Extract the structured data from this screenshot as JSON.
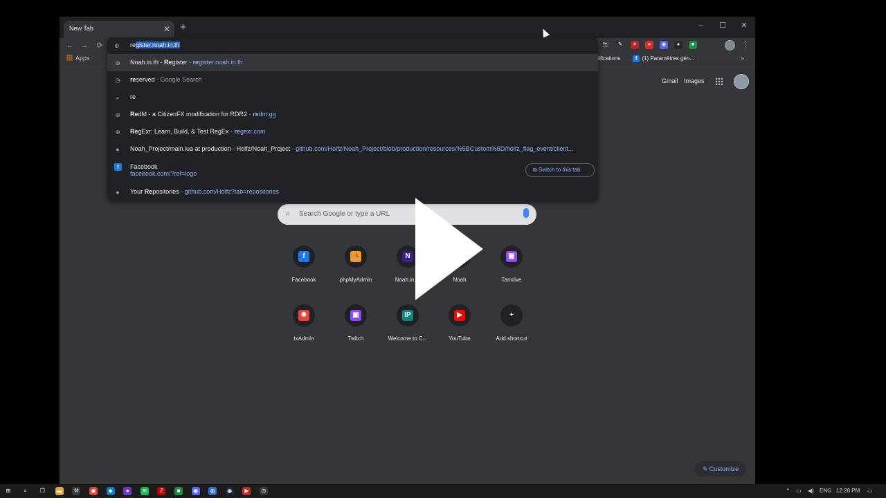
{
  "browser": {
    "tab_title": "New Tab",
    "tab_close": "✕",
    "new_tab": "+",
    "window_controls": [
      "–",
      "☐",
      "✕"
    ],
    "nav": {
      "back": "←",
      "forward": "→",
      "reload": "⟳",
      "site": "⊕"
    },
    "extensions": [
      {
        "name": "camera-extension-icon",
        "glyph": "📷",
        "color": "#35363a"
      },
      {
        "name": "pen-extension-icon",
        "glyph": "✎",
        "color": "#35363a"
      },
      {
        "name": "vpn-extension-icon",
        "glyph": "✕",
        "color": "#b3262b"
      },
      {
        "name": "ladybug-extension-icon",
        "glyph": "●",
        "color": "#d93025"
      },
      {
        "name": "discord-extension-icon",
        "glyph": "◉",
        "color": "#5865f2"
      },
      {
        "name": "github-extension-icon",
        "glyph": "●",
        "color": "#24292e"
      },
      {
        "name": "green-extension-icon",
        "glyph": "■",
        "color": "#1e8e3e"
      }
    ],
    "kebab": "⋮",
    "bookmarks": {
      "apps_label": "Apps",
      "notifications_label": "tifications",
      "parametres_label": "(1) Paramètres gén...",
      "more": "»"
    }
  },
  "omnibox": {
    "typed": "re",
    "autocomplete": "gister.noah.in.th",
    "suggestions": [
      {
        "icon": "⊕",
        "bold": "",
        "title": "Noah.in.th - ",
        "title_bold": "Re",
        "title_rest": "gister",
        "sep": " - ",
        "url_bold": "re",
        "url": "gister.noah.in.th"
      },
      {
        "icon": "◷",
        "bold": "re",
        "title": "served",
        "sep": " - ",
        "gray": "Google Search"
      },
      {
        "icon": "⌕",
        "plain": "re"
      },
      {
        "icon": "⊕",
        "bold": "Re",
        "title": "dM - a CitizenFX modification for RDR2",
        "sep": " - ",
        "url_bold": "re",
        "url": "dm.gg"
      },
      {
        "icon": "⊕",
        "bold": "Re",
        "title": "gExr: Learn, Build, & Test RegEx",
        "sep": " - ",
        "url_bold": "re",
        "url": "gexr.com"
      },
      {
        "icon": "●",
        "title": "Noah_Project/main.lua at production · Holfz/Noah_Project",
        "sep": " - ",
        "url": "github.com/Holfz/Noah_Project/blob/production/resources/%5BCustom%5D/holfz_flag_event/client..."
      },
      {
        "icon": "f",
        "title": "Facebook",
        "url": "facebook.com/?ref=logo",
        "switch_label": "Switch to this tab"
      },
      {
        "icon": "●",
        "pre": "Your ",
        "bold": "Re",
        "title": "positories",
        "sep": " - ",
        "url": "github.com/Holfz?tab=repositories"
      }
    ]
  },
  "ntp": {
    "gmail": "Gmail",
    "images": "Images",
    "search_placeholder": "Search Google or type a URL",
    "shortcuts": [
      {
        "label": "Facebook",
        "glyph": "f",
        "color": "#1877f2"
      },
      {
        "label": "phpMyAdmin",
        "glyph": "⛵",
        "color": "#f89c0e"
      },
      {
        "label": "Noah.in.th",
        "glyph": "N",
        "color": "#3b1f8c"
      },
      {
        "label": "Noah",
        "glyph": "N",
        "color": "#5f6368"
      },
      {
        "label": "Tanxlive",
        "glyph": "▣",
        "color": "#9146ff"
      },
      {
        "label": "txAdmin",
        "glyph": "✹",
        "color": "#ea4335"
      },
      {
        "label": "Twitch",
        "glyph": "▣",
        "color": "#9146ff"
      },
      {
        "label": "Welcome to C...",
        "glyph": "IP",
        "color": "#12837f"
      },
      {
        "label": "YouTube",
        "glyph": "▶",
        "color": "#ff0000"
      },
      {
        "label": "Add shortcut",
        "glyph": "+",
        "color": "#202124"
      }
    ],
    "customize": "✎  Customize"
  },
  "taskbar": {
    "apps": [
      {
        "name": "windows-start-icon",
        "glyph": "⊞",
        "color": "#1c1c1c"
      },
      {
        "name": "search-icon",
        "glyph": "⌕",
        "color": "#1c1c1c"
      },
      {
        "name": "task-view-icon",
        "glyph": "❐",
        "color": "#1c1c1c"
      },
      {
        "name": "file-explorer-icon",
        "glyph": "▬",
        "color": "#e8a33d"
      },
      {
        "name": "hammer-app-icon",
        "glyph": "⚒",
        "color": "#3a3a3a"
      },
      {
        "name": "chrome-icon",
        "glyph": "◉",
        "color": "#db4437"
      },
      {
        "name": "vscode-icon",
        "glyph": "◆",
        "color": "#007acc"
      },
      {
        "name": "purple-app-icon",
        "glyph": "●",
        "color": "#6a3cbc"
      },
      {
        "name": "spotify-icon",
        "glyph": "≋",
        "color": "#1db954"
      },
      {
        "name": "filezilla-icon",
        "glyph": "Z",
        "color": "#bf0000"
      },
      {
        "name": "green-app-icon",
        "glyph": "■",
        "color": "#1e8e3e"
      },
      {
        "name": "discord-icon",
        "glyph": "◉",
        "color": "#5865f2"
      },
      {
        "name": "blue-app-icon",
        "glyph": "◍",
        "color": "#2f6dd1"
      },
      {
        "name": "steam-icon",
        "glyph": "◉",
        "color": "#1b2838"
      },
      {
        "name": "red-app-icon",
        "glyph": "▶",
        "color": "#c62828"
      },
      {
        "name": "clock-app-icon",
        "glyph": "◷",
        "color": "#3a3a3a"
      }
    ],
    "tray_arrow": "⌃",
    "language": "ENG",
    "time": "12:28 PM",
    "notification": "▭"
  }
}
